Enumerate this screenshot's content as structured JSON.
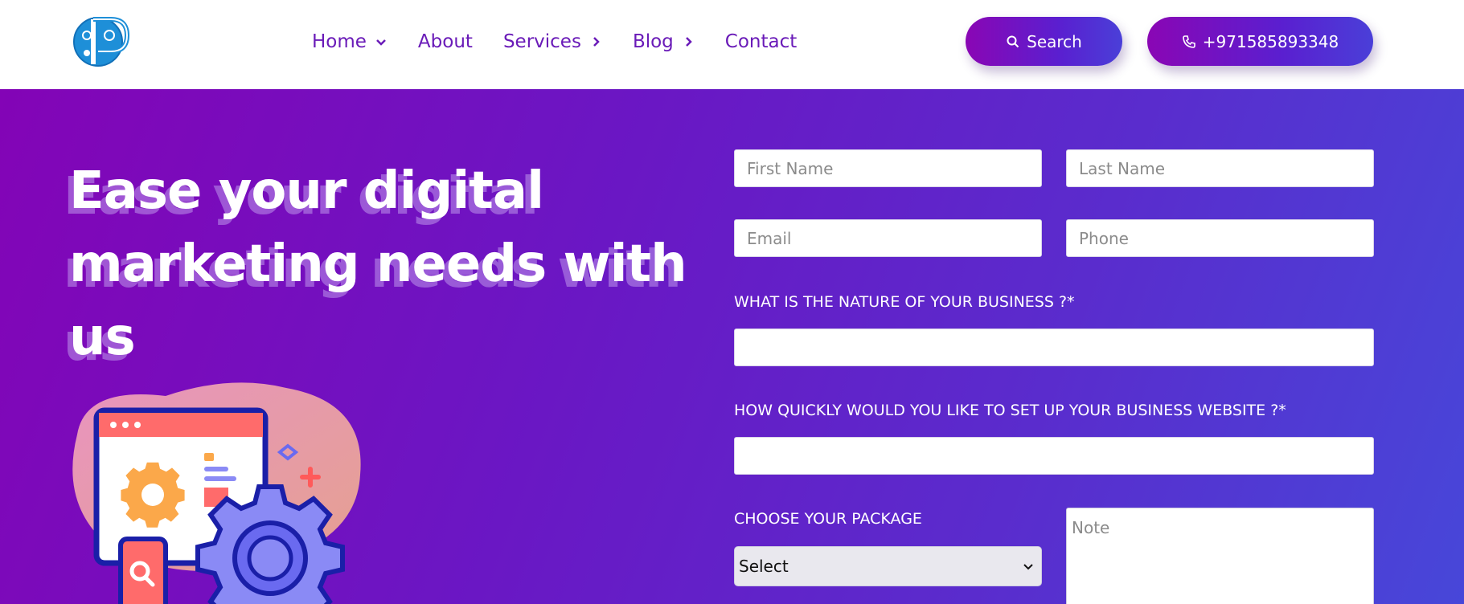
{
  "header": {
    "nav": [
      {
        "label": "Home",
        "has_dropdown": true
      },
      {
        "label": "About",
        "has_dropdown": false
      },
      {
        "label": "Services",
        "has_dropdown": true
      },
      {
        "label": "Blog",
        "has_dropdown": true
      },
      {
        "label": "Contact",
        "has_dropdown": false
      }
    ],
    "search_label": "Search",
    "phone_label": "+971585893348"
  },
  "hero": {
    "headline_lines": [
      "Ease your digital",
      "marketing needs with",
      "us"
    ]
  },
  "form": {
    "first_name_placeholder": "First Name",
    "last_name_placeholder": "Last Name",
    "email_placeholder": "Email",
    "phone_placeholder": "Phone",
    "nature_label": "WHAT IS THE NATURE OF YOUR BUSINESS ?*",
    "nature_value": "",
    "quick_label": "HOW QUICKLY WOULD YOU LIKE TO SET UP YOUR BUSINESS WEBSITE ?*",
    "quick_value": "",
    "package_label": "CHOOSE YOUR PACKAGE",
    "package_selected": "Select",
    "note_placeholder": "Note"
  },
  "colors": {
    "nav_text": "#6a1bb8",
    "gradient_start": "#8304b6",
    "gradient_end": "#4747d9",
    "button_gradient_start": "#8a06b4",
    "button_gradient_end": "#4a3fd8"
  },
  "icons": {
    "logo": "p-logo-icon",
    "search": "search-icon",
    "phone": "phone-icon",
    "chevron_down": "chevron-down-icon",
    "chevron_right": "chevron-right-icon",
    "illustration": "settings-dashboard-illustration"
  }
}
